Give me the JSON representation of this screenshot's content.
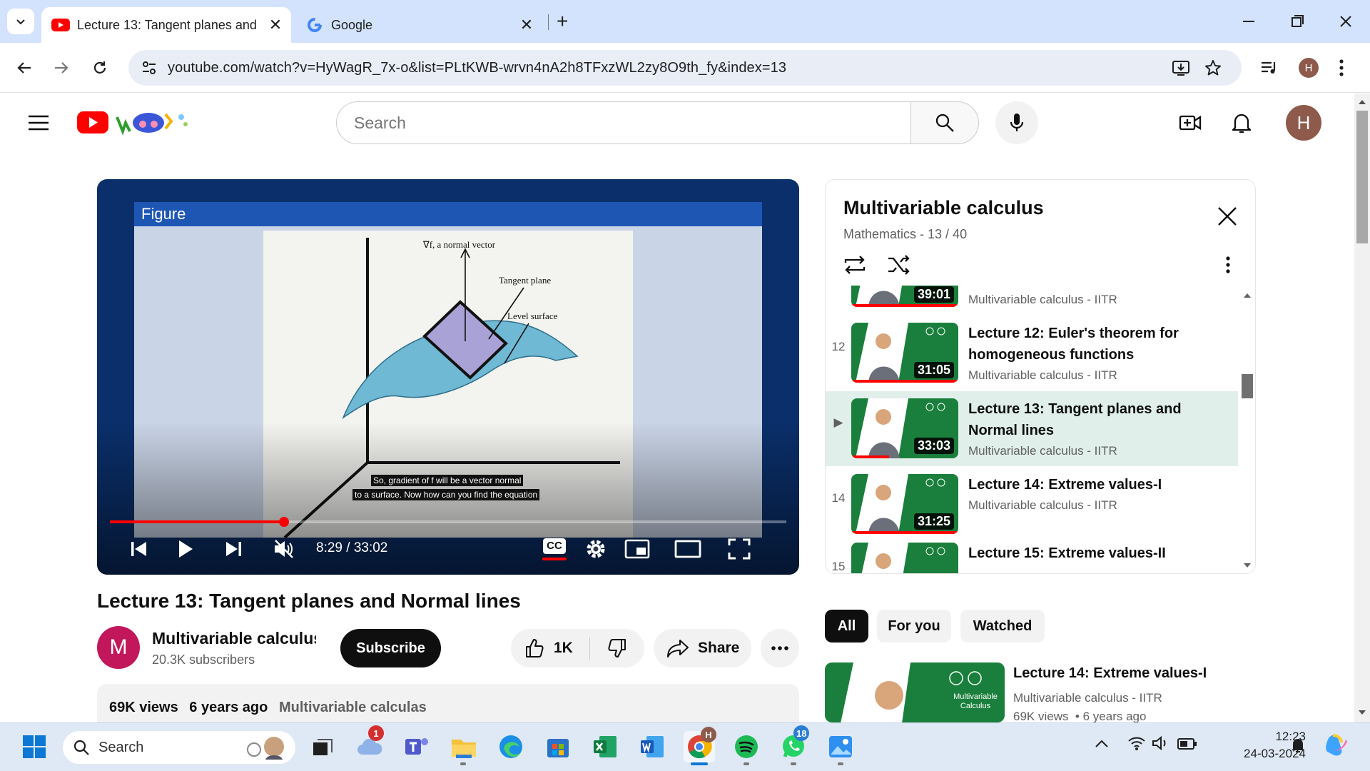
{
  "browser": {
    "tabs": [
      {
        "title": "Lecture 13: Tangent planes and",
        "active": true,
        "icon": "youtube-favicon"
      },
      {
        "title": "Google",
        "active": false,
        "icon": "google-favicon"
      }
    ],
    "new_tab_symbol": "+",
    "url": "youtube.com/watch?v=HyWagR_7x-o&list=PLtKWB-wrvn4nA2h8TFxzWL2zy8O9th_fy&index=13",
    "profile_initial": "H",
    "window_controls": [
      "minimize",
      "restore",
      "close"
    ]
  },
  "youtube": {
    "search_placeholder": "Search",
    "avatar_initial": "H",
    "accent": "#ff0000",
    "player": {
      "slide_header": "Figure",
      "figure_labels": {
        "normal_vector": "∇f, a normal vector",
        "tangent_plane": "Tangent plane",
        "level_surface": "Level surface"
      },
      "caption_line1": "So, gradient of f will be a vector normal",
      "caption_line2": "to a surface. Now how can you find the equation",
      "time": "8:29 / 33:02",
      "progress": 0.257,
      "cc_label": "CC"
    },
    "video": {
      "title": "Lecture 13: Tangent planes and Normal lines",
      "channel_initial": "M",
      "channel_name": "Multivariable calculus",
      "subscribers": "20.3K subscribers",
      "subscribe_label": "Subscribe",
      "likes": "1K",
      "share_label": "Share",
      "views": "69K views",
      "age": "6 years ago",
      "tags": "Multivariable calculas"
    },
    "playlist": {
      "title": "Multivariable calculus",
      "subtitle": "Mathematics - 13 / 40",
      "items": [
        {
          "index": "",
          "title": "",
          "channel": "Multivariable calculus - IITR",
          "duration": "39:01",
          "watched": 1.0
        },
        {
          "index": "12",
          "title": "Lecture 12: Euler's theorem for homogeneous functions",
          "channel": "Multivariable calculus - IITR",
          "duration": "31:05",
          "watched": 1.0
        },
        {
          "index": "▶",
          "title": "Lecture 13: Tangent planes and Normal lines",
          "channel": "Multivariable calculus - IITR",
          "duration": "33:03",
          "watched": 0.35
        },
        {
          "index": "14",
          "title": "Lecture 14: Extreme values-I",
          "channel": "Multivariable calculus - IITR",
          "duration": "31:25",
          "watched": 1.0
        },
        {
          "index": "15",
          "title": "Lecture 15: Extreme values-II",
          "channel": "Multivariable calculus - IITR",
          "duration": "",
          "watched": 0
        }
      ]
    },
    "chips": [
      "All",
      "For you",
      "Watched"
    ],
    "recommended": {
      "title": "Lecture 14: Extreme values-I",
      "channel": "Multivariable calculus - IITR",
      "meta": "69K views  • 6 years ago",
      "thumb_text": "Multivariable Calculus"
    }
  },
  "taskbar": {
    "search_placeholder": "Search",
    "time": "12:23",
    "date": "24-03-2024",
    "badges": {
      "weather": "1",
      "whatsapp": "18",
      "chrome_profile": "H"
    }
  }
}
